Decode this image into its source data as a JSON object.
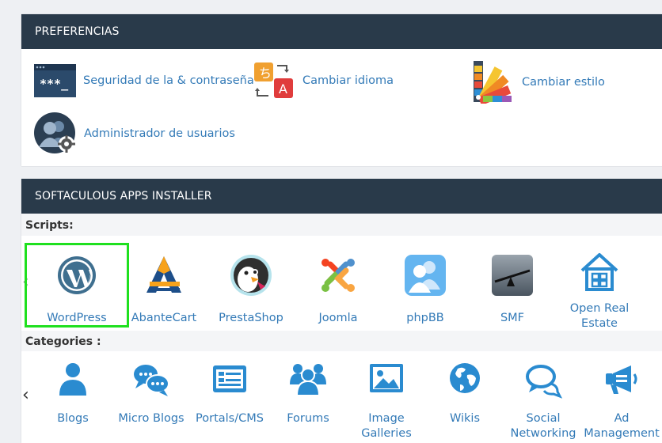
{
  "preferences": {
    "title": "PREFERENCIAS",
    "items": [
      {
        "label": "Seguridad de la & contraseña",
        "icon": "password-security-icon"
      },
      {
        "label": "Cambiar idioma",
        "icon": "change-language-icon"
      },
      {
        "label": "Cambiar estilo",
        "icon": "change-style-icon"
      },
      {
        "label": "Administrador de usuarios",
        "icon": "user-manager-icon"
      }
    ]
  },
  "softaculous": {
    "title": "SOFTACULOUS APPS INSTALLER",
    "scripts_label": "Scripts:",
    "categories_label": "Categories :",
    "scripts": [
      {
        "name": "WordPress",
        "icon": "wordpress-icon",
        "selected": true
      },
      {
        "name": "AbanteCart",
        "icon": "abantecart-icon"
      },
      {
        "name": "PrestaShop",
        "icon": "prestashop-icon"
      },
      {
        "name": "Joomla",
        "icon": "joomla-icon"
      },
      {
        "name": "phpBB",
        "icon": "phpbb-icon"
      },
      {
        "name": "SMF",
        "icon": "smf-icon"
      },
      {
        "name": "Open Real Estate",
        "icon": "open-real-estate-icon"
      }
    ],
    "categories": [
      {
        "name": "Blogs",
        "icon": "user-icon"
      },
      {
        "name": "Micro Blogs",
        "icon": "chat-bubbles-icon"
      },
      {
        "name": "Portals/CMS",
        "icon": "newspaper-icon"
      },
      {
        "name": "Forums",
        "icon": "users-group-icon"
      },
      {
        "name": "Image Galleries",
        "icon": "image-icon"
      },
      {
        "name": "Wikis",
        "icon": "globe-icon"
      },
      {
        "name": "Social Networking",
        "icon": "comments-icon"
      },
      {
        "name": "Ad Management",
        "icon": "megaphone-icon"
      }
    ]
  },
  "colors": {
    "header_bg": "#293a4a",
    "link": "#337ab7",
    "icon_blue": "#2a8bd0",
    "highlight": "#1fe01f"
  }
}
